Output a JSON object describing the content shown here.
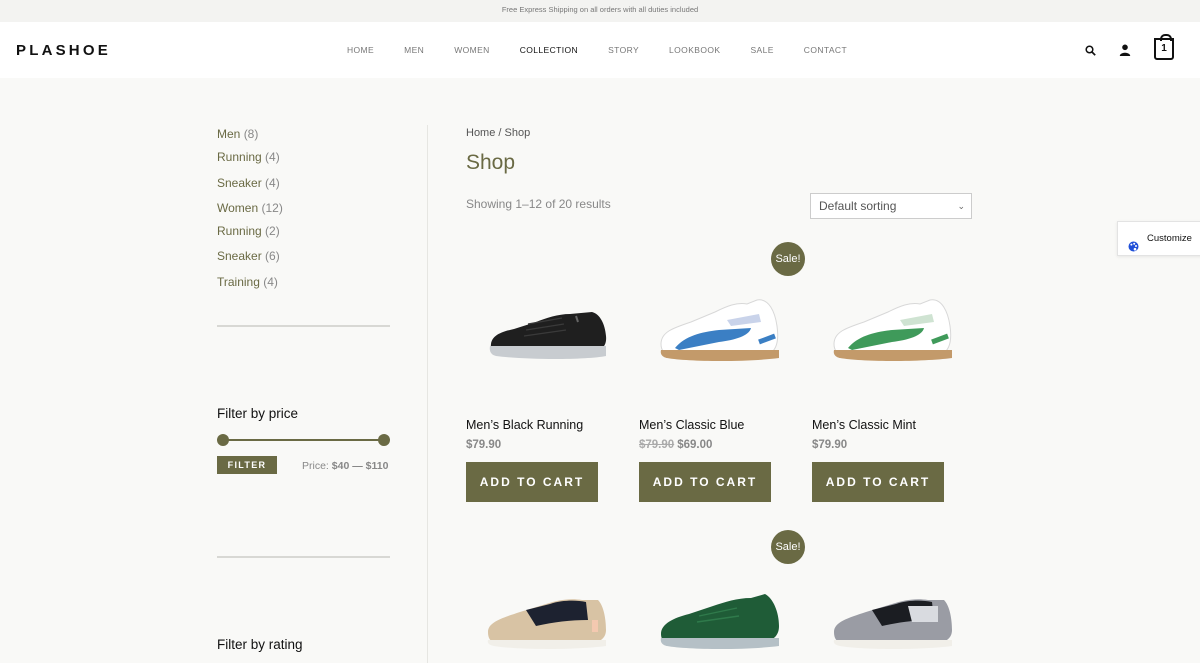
{
  "topbar": {
    "text": "Free Express Shipping on all orders with all duties included"
  },
  "header": {
    "logo": "PLASHOE",
    "nav": [
      {
        "label": "HOME",
        "active": false
      },
      {
        "label": "MEN",
        "active": false
      },
      {
        "label": "WOMEN",
        "active": false
      },
      {
        "label": "COLLECTION",
        "active": true
      },
      {
        "label": "STORY",
        "active": false
      },
      {
        "label": "LOOKBOOK",
        "active": false
      },
      {
        "label": "SALE",
        "active": false
      },
      {
        "label": "CONTACT",
        "active": false
      }
    ],
    "cart_count": "1",
    "icons": [
      "search-icon",
      "user-icon",
      "shopping-bag-icon"
    ]
  },
  "sidebar": {
    "categories": [
      {
        "name": "Men",
        "count": "(8)"
      },
      {
        "name": "Running",
        "count": "(4)"
      },
      {
        "name": "Sneaker",
        "count": "(4)"
      },
      {
        "name": "Women",
        "count": "(12)"
      },
      {
        "name": "Running",
        "count": "(2)"
      },
      {
        "name": "Sneaker",
        "count": "(6)"
      },
      {
        "name": "Training",
        "count": "(4)"
      }
    ],
    "filter_price": {
      "heading": "Filter by price",
      "button": "FILTER",
      "price_label": "Price:",
      "min": "$40",
      "separator": "—",
      "max": "$110",
      "slider_min_fraction": 0,
      "slider_max_fraction": 1
    },
    "filter_rating": {
      "heading": "Filter by rating"
    }
  },
  "main": {
    "breadcrumb": {
      "home": "Home",
      "separator": "/",
      "current": "Shop"
    },
    "title": "Shop",
    "results": "Showing 1–12 of 20 results",
    "sort": {
      "selected": "Default sorting"
    },
    "add_to_cart_label": "ADD TO CART",
    "sale_label": "Sale!",
    "products": [
      {
        "name": "Men’s Black Running",
        "price": "$79.90",
        "old_price": "",
        "sale": false
      },
      {
        "name": "Men’s Classic Blue",
        "price": "$69.00",
        "old_price": "$79.90",
        "sale": true
      },
      {
        "name": "Men’s Classic Mint",
        "price": "$79.90",
        "old_price": "",
        "sale": false
      },
      {
        "name": "",
        "price": "",
        "old_price": "",
        "sale": false
      },
      {
        "name": "",
        "price": "",
        "old_price": "",
        "sale": true
      },
      {
        "name": "",
        "price": "",
        "old_price": "",
        "sale": false
      }
    ]
  },
  "customize": {
    "label": "Customize"
  },
  "colors": {
    "accent": "#6a6a44",
    "background": "#f9f9f7",
    "header_bg": "#ffffff"
  }
}
